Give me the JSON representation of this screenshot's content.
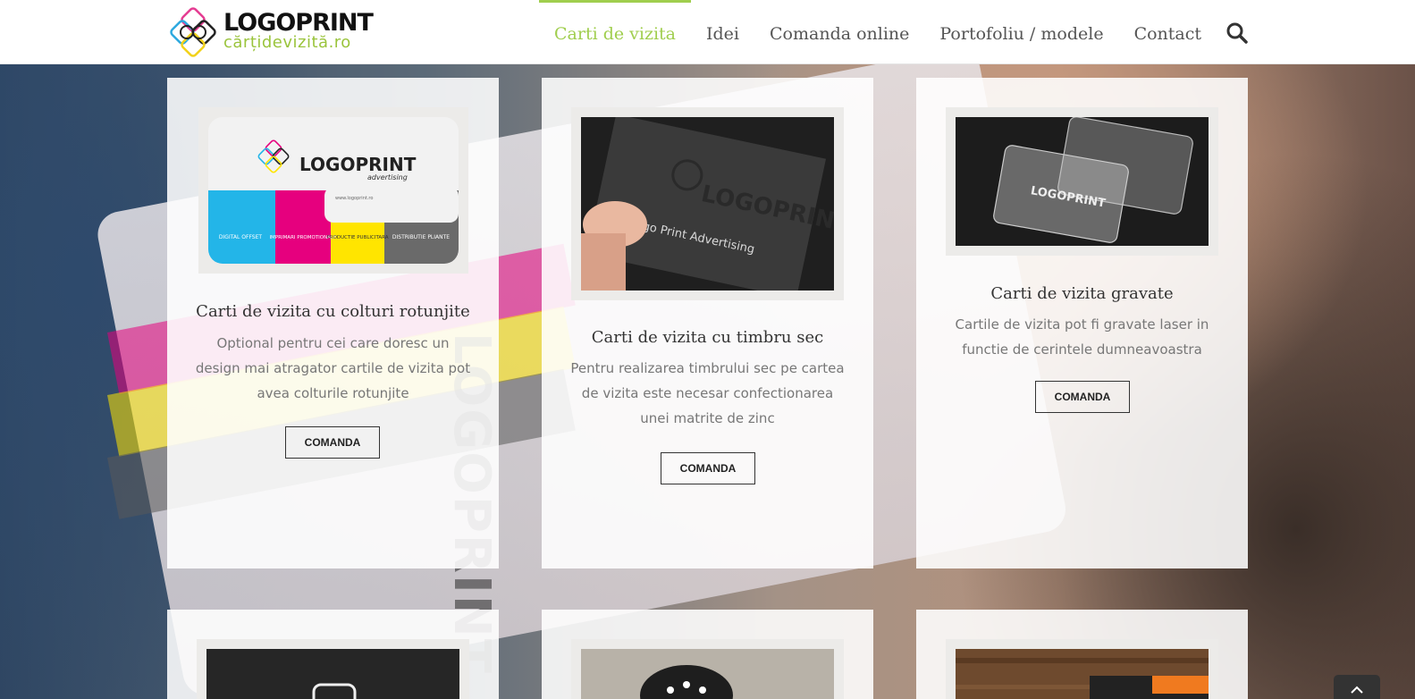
{
  "header": {
    "logo": {
      "title": "LOGOPRINT",
      "subtitle": "cărțidevizită.ro"
    },
    "nav": [
      {
        "label": "Carti de vizita",
        "active": true
      },
      {
        "label": "Idei",
        "active": false
      },
      {
        "label": "Comanda online",
        "active": false
      },
      {
        "label": "Portofoliu / modele",
        "active": false
      },
      {
        "label": "Contact",
        "active": false
      }
    ],
    "search_icon": "search-icon"
  },
  "cards": [
    {
      "title": "Carti de vizita cu colturi rotunjite",
      "description": "Optional pentru cei care doresc un design mai atragator cartile de vizita pot avea colturile rotunjite",
      "button": "COMANDA",
      "image": {
        "logo": "LOGOPRINT",
        "tagline": "advertising",
        "url": "www.logoprint.ro",
        "segments": [
          "DIGITAL OFFSET",
          "IMPRIMARI PROMOTIONALE",
          "PRODUCTIE PUBLICITARA",
          "DISTRIBUTIE PLIANTE"
        ]
      }
    },
    {
      "title": "Carti de vizita cu timbru sec",
      "description": "Pentru realizarea timbrului sec pe cartea de vizita este necesar confectionarea unei matrite de zinc",
      "button": "COMANDA",
      "image": {
        "logo": "LOGOPRINT",
        "text": "Logo Print Advertising"
      }
    },
    {
      "title": "Carti de vizita gravate",
      "description": "Cartile de vizita pot fi gravate laser in functie de cerintele dumneavoastra",
      "button": "COMANDA",
      "image": {
        "logo": "LOGOPRINT"
      }
    }
  ],
  "colors": {
    "accent": "#a0ce4e",
    "text": "#333333",
    "muted": "#777777"
  },
  "scroll_top_icon": "chevron-up-icon"
}
